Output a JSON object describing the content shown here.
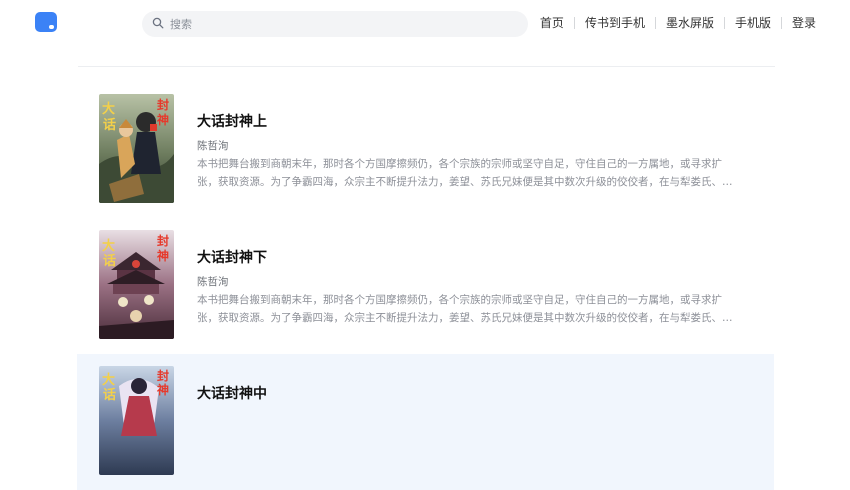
{
  "search": {
    "placeholder": "搜索"
  },
  "nav": {
    "items": [
      {
        "label": "首页"
      },
      {
        "label": "传书到手机"
      },
      {
        "label": "墨水屏版"
      },
      {
        "label": "手机版"
      },
      {
        "label": "登录"
      }
    ]
  },
  "books": [
    {
      "title": "大话封神上",
      "author": "陈哲洵",
      "desc": "本书把舞台搬到商朝末年，那时各个方国摩擦频仍，各个宗族的宗师或坚守自足，守住自己的一方属地，或寻求扩张，获取资源。为了争霸四海，众宗主不断提升法力，姜望、苏氏兄妹便是其中数次升级的佼佼者，在与犁娄氏、有邰氏、伊耆氏…",
      "cover_text": [
        "大",
        "话",
        "封",
        "神"
      ]
    },
    {
      "title": "大话封神下",
      "author": "陈哲洵",
      "desc": "本书把舞台搬到商朝末年，那时各个方国摩擦频仍，各个宗族的宗师或坚守自足，守住自己的一方属地，或寻求扩张，获取资源。为了争霸四海，众宗主不断提升法力，姜望、苏氏兄妹便是其中数次升级的佼佼者，在与犁娄氏、有邰氏、伊耆氏…",
      "cover_text": [
        "大",
        "话",
        "封",
        "神"
      ]
    },
    {
      "title": "大话封神中",
      "author": "",
      "desc": "",
      "cover_text": [
        "大",
        "话",
        "封",
        "神"
      ]
    }
  ],
  "colors": {
    "logo": "#3b82f6",
    "active_row": "#f1f6fd",
    "divider": "#eceef1"
  }
}
